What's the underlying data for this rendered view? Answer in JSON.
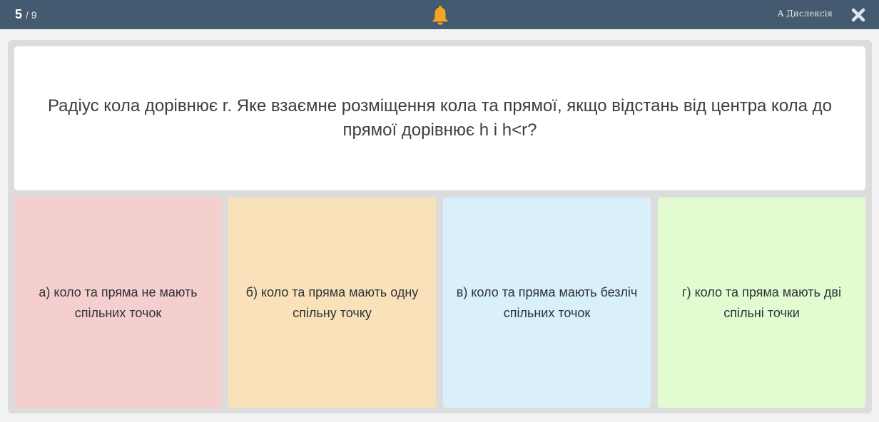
{
  "header": {
    "current": "5",
    "total": "/ 9",
    "dyslexia_label": "A Дислексія",
    "bell_icon": "bell-icon",
    "close_icon": "close-icon",
    "background": "#435a70",
    "bell_color": "#f5a623"
  },
  "question": {
    "text": "Радіус кола дорівнює r. Яке взаємне розміщення кола та прямої, якщо відстань від центра кола до прямої дорівнює h і h<r?"
  },
  "answers": [
    {
      "label": "а) коло та пряма не мають спільних точок",
      "color": "#f5cece"
    },
    {
      "label": "б) коло та пряма мають одну спільну точку",
      "color": "#f9e1b9"
    },
    {
      "label": "в) коло та пряма мають безліч спільних точок",
      "color": "#d9eff9"
    },
    {
      "label": "г) коло та пряма мають дві спільні точки",
      "color": "#e2fbd0"
    }
  ]
}
